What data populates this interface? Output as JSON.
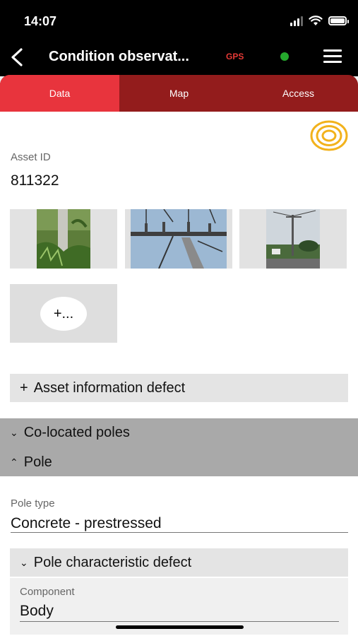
{
  "status": {
    "time": "14:07"
  },
  "header": {
    "title": "Condition observat...",
    "gps_label": "GPS",
    "gps_color": "#25a82d",
    "accent": "#e8343d",
    "tab_bg": "#931c1c"
  },
  "tabs": [
    {
      "label": "Data",
      "active": true
    },
    {
      "label": "Map",
      "active": false
    },
    {
      "label": "Access",
      "active": false
    }
  ],
  "asset": {
    "label": "Asset ID",
    "value": "811322"
  },
  "photos": [
    "photo-pole-vegetation",
    "photo-pole-crossarm",
    "photo-pole-street"
  ],
  "add_photo": {
    "label": "+..."
  },
  "sections": {
    "asset_info_defect": "Asset information defect",
    "co_located_poles": "Co-located poles",
    "pole": "Pole",
    "pole_characteristic_defect": "Pole characteristic defect"
  },
  "fields": {
    "pole_type": {
      "label": "Pole type",
      "value": "Concrete - prestressed"
    },
    "component": {
      "label": "Component",
      "value": "Body"
    }
  },
  "icons": {
    "back": "chevron-left-icon",
    "menu": "hamburger-menu-icon",
    "gold": "concentric-rings-icon"
  }
}
